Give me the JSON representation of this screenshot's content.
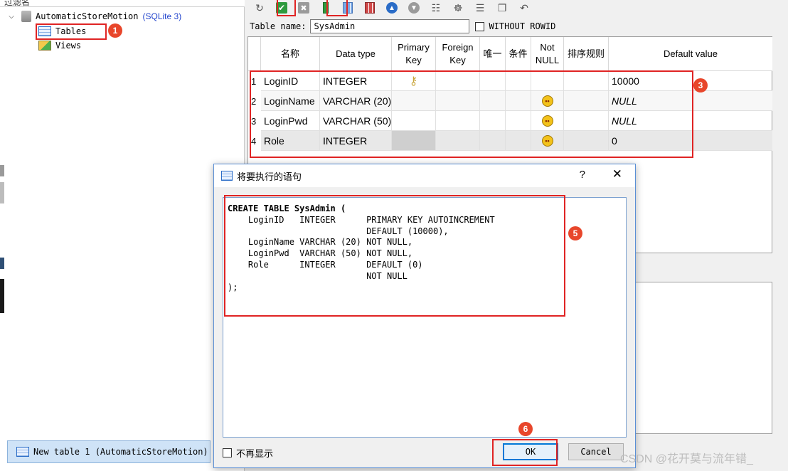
{
  "sidebar": {
    "filter_label": "过滤名",
    "db_name": "AutomaticStoreMotion",
    "db_type": "(SQLite 3)",
    "items": [
      {
        "label": "Tables"
      },
      {
        "label": "Views"
      }
    ],
    "taskbar_tab": "New table 1 (AutomaticStoreMotion)"
  },
  "editor": {
    "table_name_label": "Table name:",
    "table_name_value": "SysAdmin",
    "without_rowid_label": "WITHOUT ROWID",
    "columns": [
      {
        "label": "名称"
      },
      {
        "label": "Data type"
      },
      {
        "label": "Primary Key"
      },
      {
        "label": "Foreign Key"
      },
      {
        "label": "唯一"
      },
      {
        "label": "条件"
      },
      {
        "label": "Not NULL"
      },
      {
        "label": "排序规则"
      },
      {
        "label": "Default value"
      }
    ],
    "rows": [
      {
        "num": "1",
        "name": "LoginID",
        "type": "INTEGER",
        "default": "10000"
      },
      {
        "num": "2",
        "name": "LoginName",
        "type": "VARCHAR (20)",
        "default": "NULL"
      },
      {
        "num": "3",
        "name": "LoginPwd",
        "type": "VARCHAR (50)",
        "default": "NULL"
      },
      {
        "num": "4",
        "name": "Role",
        "type": "INTEGER",
        "default": "0"
      }
    ]
  },
  "dialog": {
    "title": "将要执行的语句",
    "help": "?",
    "close": "✕",
    "sql_lines": [
      "CREATE TABLE SysAdmin (",
      "    LoginID   INTEGER      PRIMARY KEY AUTOINCREMENT",
      "                           DEFAULT (10000),",
      "    LoginName VARCHAR (20) NOT NULL,",
      "    LoginPwd  VARCHAR (50) NOT NULL,",
      "    Role      INTEGER      DEFAULT (0)",
      "                           NOT NULL",
      ");"
    ],
    "dont_show_label": "不再显示",
    "ok_label": "OK",
    "cancel_label": "Cancel"
  },
  "annotations": [
    "1",
    "3",
    "5",
    "6"
  ],
  "watermark": "CSDN @花开莫与流年错_"
}
